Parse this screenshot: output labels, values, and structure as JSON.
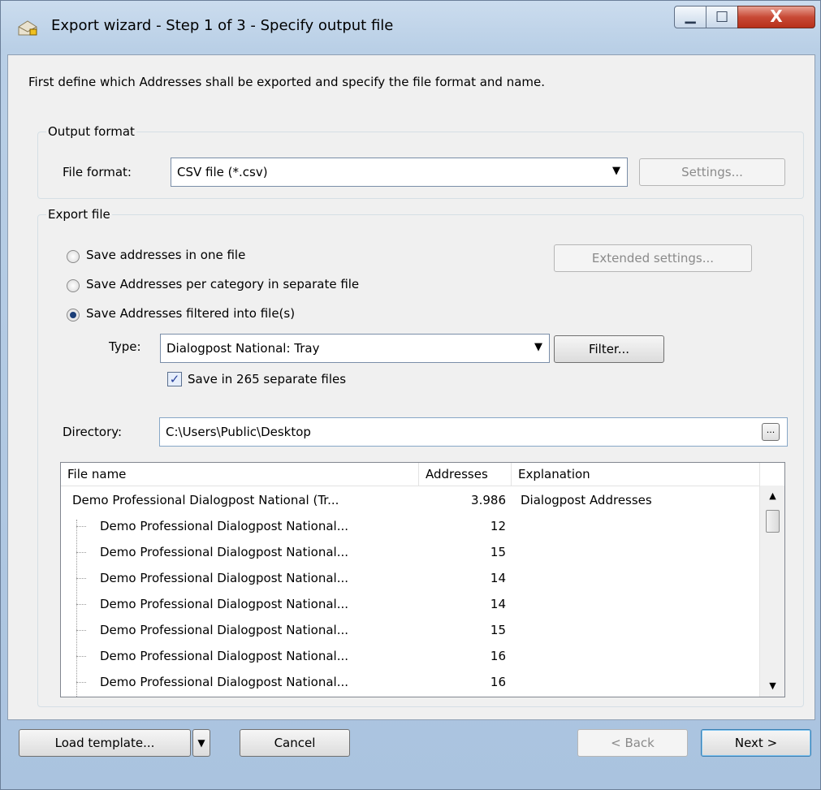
{
  "window": {
    "title": "Export wizard - Step 1 of 3 - Specify output file",
    "icons": {
      "app": "export-envelope-icon",
      "minimize": "minimize-icon",
      "maximize": "maximize-icon",
      "close": "close-icon"
    },
    "min_glyph": "▁",
    "max_glyph": "□",
    "close_glyph": "X"
  },
  "intro": "First define which Addresses shall be exported and specify the file format and name.",
  "output_format": {
    "legend": "Output format",
    "file_format_label": "File format:",
    "file_format_value": "CSV file (*.csv)",
    "settings_button": "Settings..."
  },
  "export_file": {
    "legend": "Export file",
    "radio_one_file": "Save addresses in one file",
    "radio_per_category": "Save Addresses per category in separate file",
    "radio_filtered": "Save Addresses filtered into file(s)",
    "selected_option": "filtered",
    "extended_settings_button": "Extended settings...",
    "type_label": "Type:",
    "type_value": "Dialogpost National: Tray",
    "filter_button": "Filter...",
    "separate_files_label": "Save in 265 separate files",
    "separate_files_checked": true,
    "directory_label": "Directory:",
    "directory_value": "C:\\Users\\Public\\Desktop",
    "browse_label": "..."
  },
  "file_list": {
    "headers": [
      "File name",
      "Addresses",
      "Explanation"
    ],
    "rows": [
      {
        "name": "Demo Professional Dialogpost National (Tr...",
        "addresses": "3.986",
        "explanation": "Dialogpost Addresses",
        "level": 0
      },
      {
        "name": "Demo Professional Dialogpost National...",
        "addresses": "12",
        "explanation": "",
        "level": 1
      },
      {
        "name": "Demo Professional Dialogpost National...",
        "addresses": "15",
        "explanation": "",
        "level": 1
      },
      {
        "name": "Demo Professional Dialogpost National...",
        "addresses": "14",
        "explanation": "",
        "level": 1
      },
      {
        "name": "Demo Professional Dialogpost National...",
        "addresses": "14",
        "explanation": "",
        "level": 1
      },
      {
        "name": "Demo Professional Dialogpost National...",
        "addresses": "15",
        "explanation": "",
        "level": 1
      },
      {
        "name": "Demo Professional Dialogpost National...",
        "addresses": "16",
        "explanation": "",
        "level": 1
      },
      {
        "name": "Demo Professional Dialogpost National...",
        "addresses": "16",
        "explanation": "",
        "level": 1
      }
    ]
  },
  "footer": {
    "load_template_button": "Load template...",
    "cancel_button": "Cancel",
    "back_button": "< Back",
    "next_button": "Next >"
  }
}
